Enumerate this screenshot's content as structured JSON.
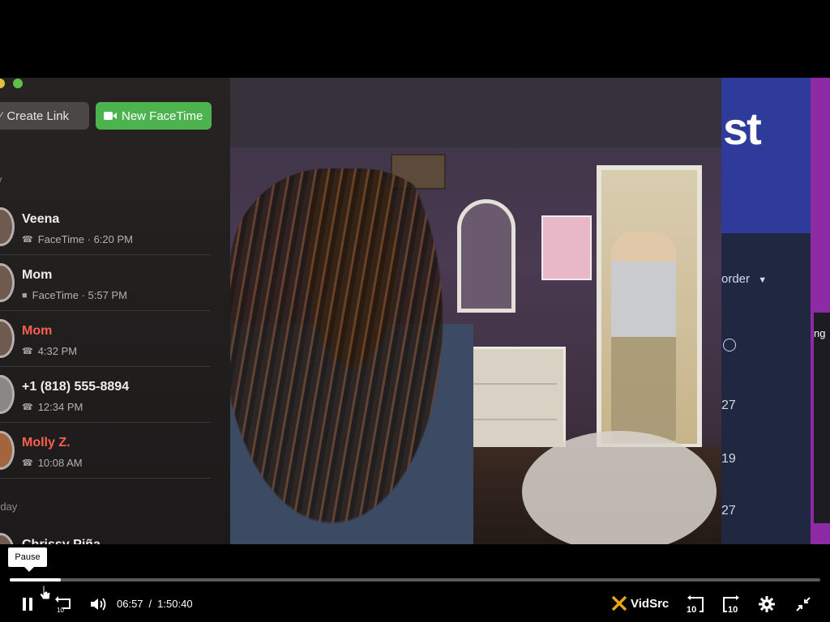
{
  "facetime": {
    "create_link_label": "Create Link",
    "new_facetime_label": "New FaceTime",
    "section_today": "y",
    "section_yesterday": "rday",
    "calls": [
      {
        "name": "Veena",
        "detail": "FaceTime · 6:20 PM",
        "kind": "video",
        "missed": false
      },
      {
        "name": "Mom",
        "detail": "FaceTime · 5:57 PM",
        "kind": "video",
        "missed": false
      },
      {
        "name": "Mom",
        "detail": "4:32 PM",
        "kind": "phone",
        "missed": true
      },
      {
        "name": "+1 (818) 555-8894",
        "detail": "12:34 PM",
        "kind": "phone",
        "missed": false
      },
      {
        "name": "Molly Z.",
        "detail": "10:08 AM",
        "kind": "phone",
        "missed": true
      },
      {
        "name": "Chrissy Piña",
        "detail": "",
        "kind": "phone",
        "missed": false
      }
    ]
  },
  "right_panel": {
    "banner_text": "st",
    "sort_label": "order",
    "rows": [
      "27",
      "19",
      "27"
    ],
    "side_text": "ng"
  },
  "player": {
    "tooltip": "Pause",
    "current_time": "06:57",
    "separator": "/",
    "duration": "1:50:40",
    "progress_fraction": 0.063,
    "buffered_fraction": 0.063,
    "brand": "VidSrc",
    "skip_seconds": "10"
  },
  "colors": {
    "facetime_green": "#4cb34f",
    "missed_red": "#ff5f4f",
    "banner_blue": "#2f3b9a",
    "purple_strip": "#8e2aa3"
  }
}
